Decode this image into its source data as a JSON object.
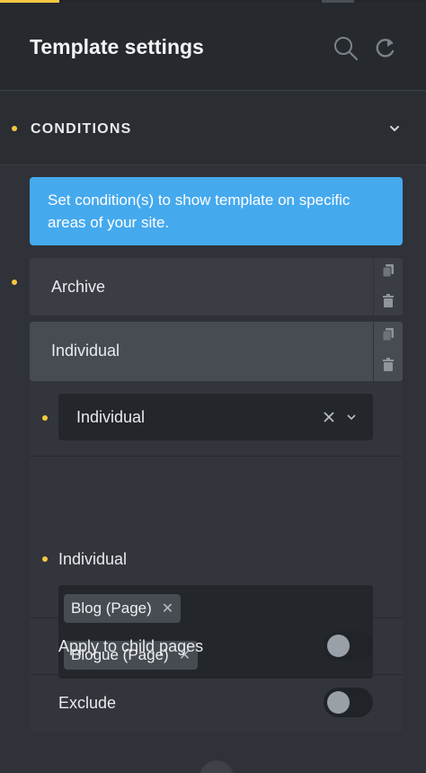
{
  "header": {
    "title": "Template settings",
    "icons": [
      "search-icon",
      "reset-icon"
    ]
  },
  "section": {
    "label": "CONDITIONS",
    "expanded": true
  },
  "info": {
    "text": "Set condition(s) to show template on specific areas of your site."
  },
  "conditions": [
    {
      "label": "Archive",
      "actions": [
        "copy-icon",
        "trash-icon"
      ]
    },
    {
      "label": "Individual",
      "actions": [
        "copy-icon",
        "trash-icon"
      ]
    }
  ],
  "individual_settings": {
    "select_value": "Individual",
    "field_label": "Individual",
    "tags": [
      {
        "label": "Blog (Page)"
      },
      {
        "label": "Blogue (Page)"
      }
    ],
    "apply_child_label": "Apply to child pages",
    "apply_child_on": false,
    "exclude_label": "Exclude",
    "exclude_on": false
  },
  "colors": {
    "accent": "#f5c842",
    "info_bg": "#45a9ee",
    "panel_bg": "#2f3238"
  }
}
